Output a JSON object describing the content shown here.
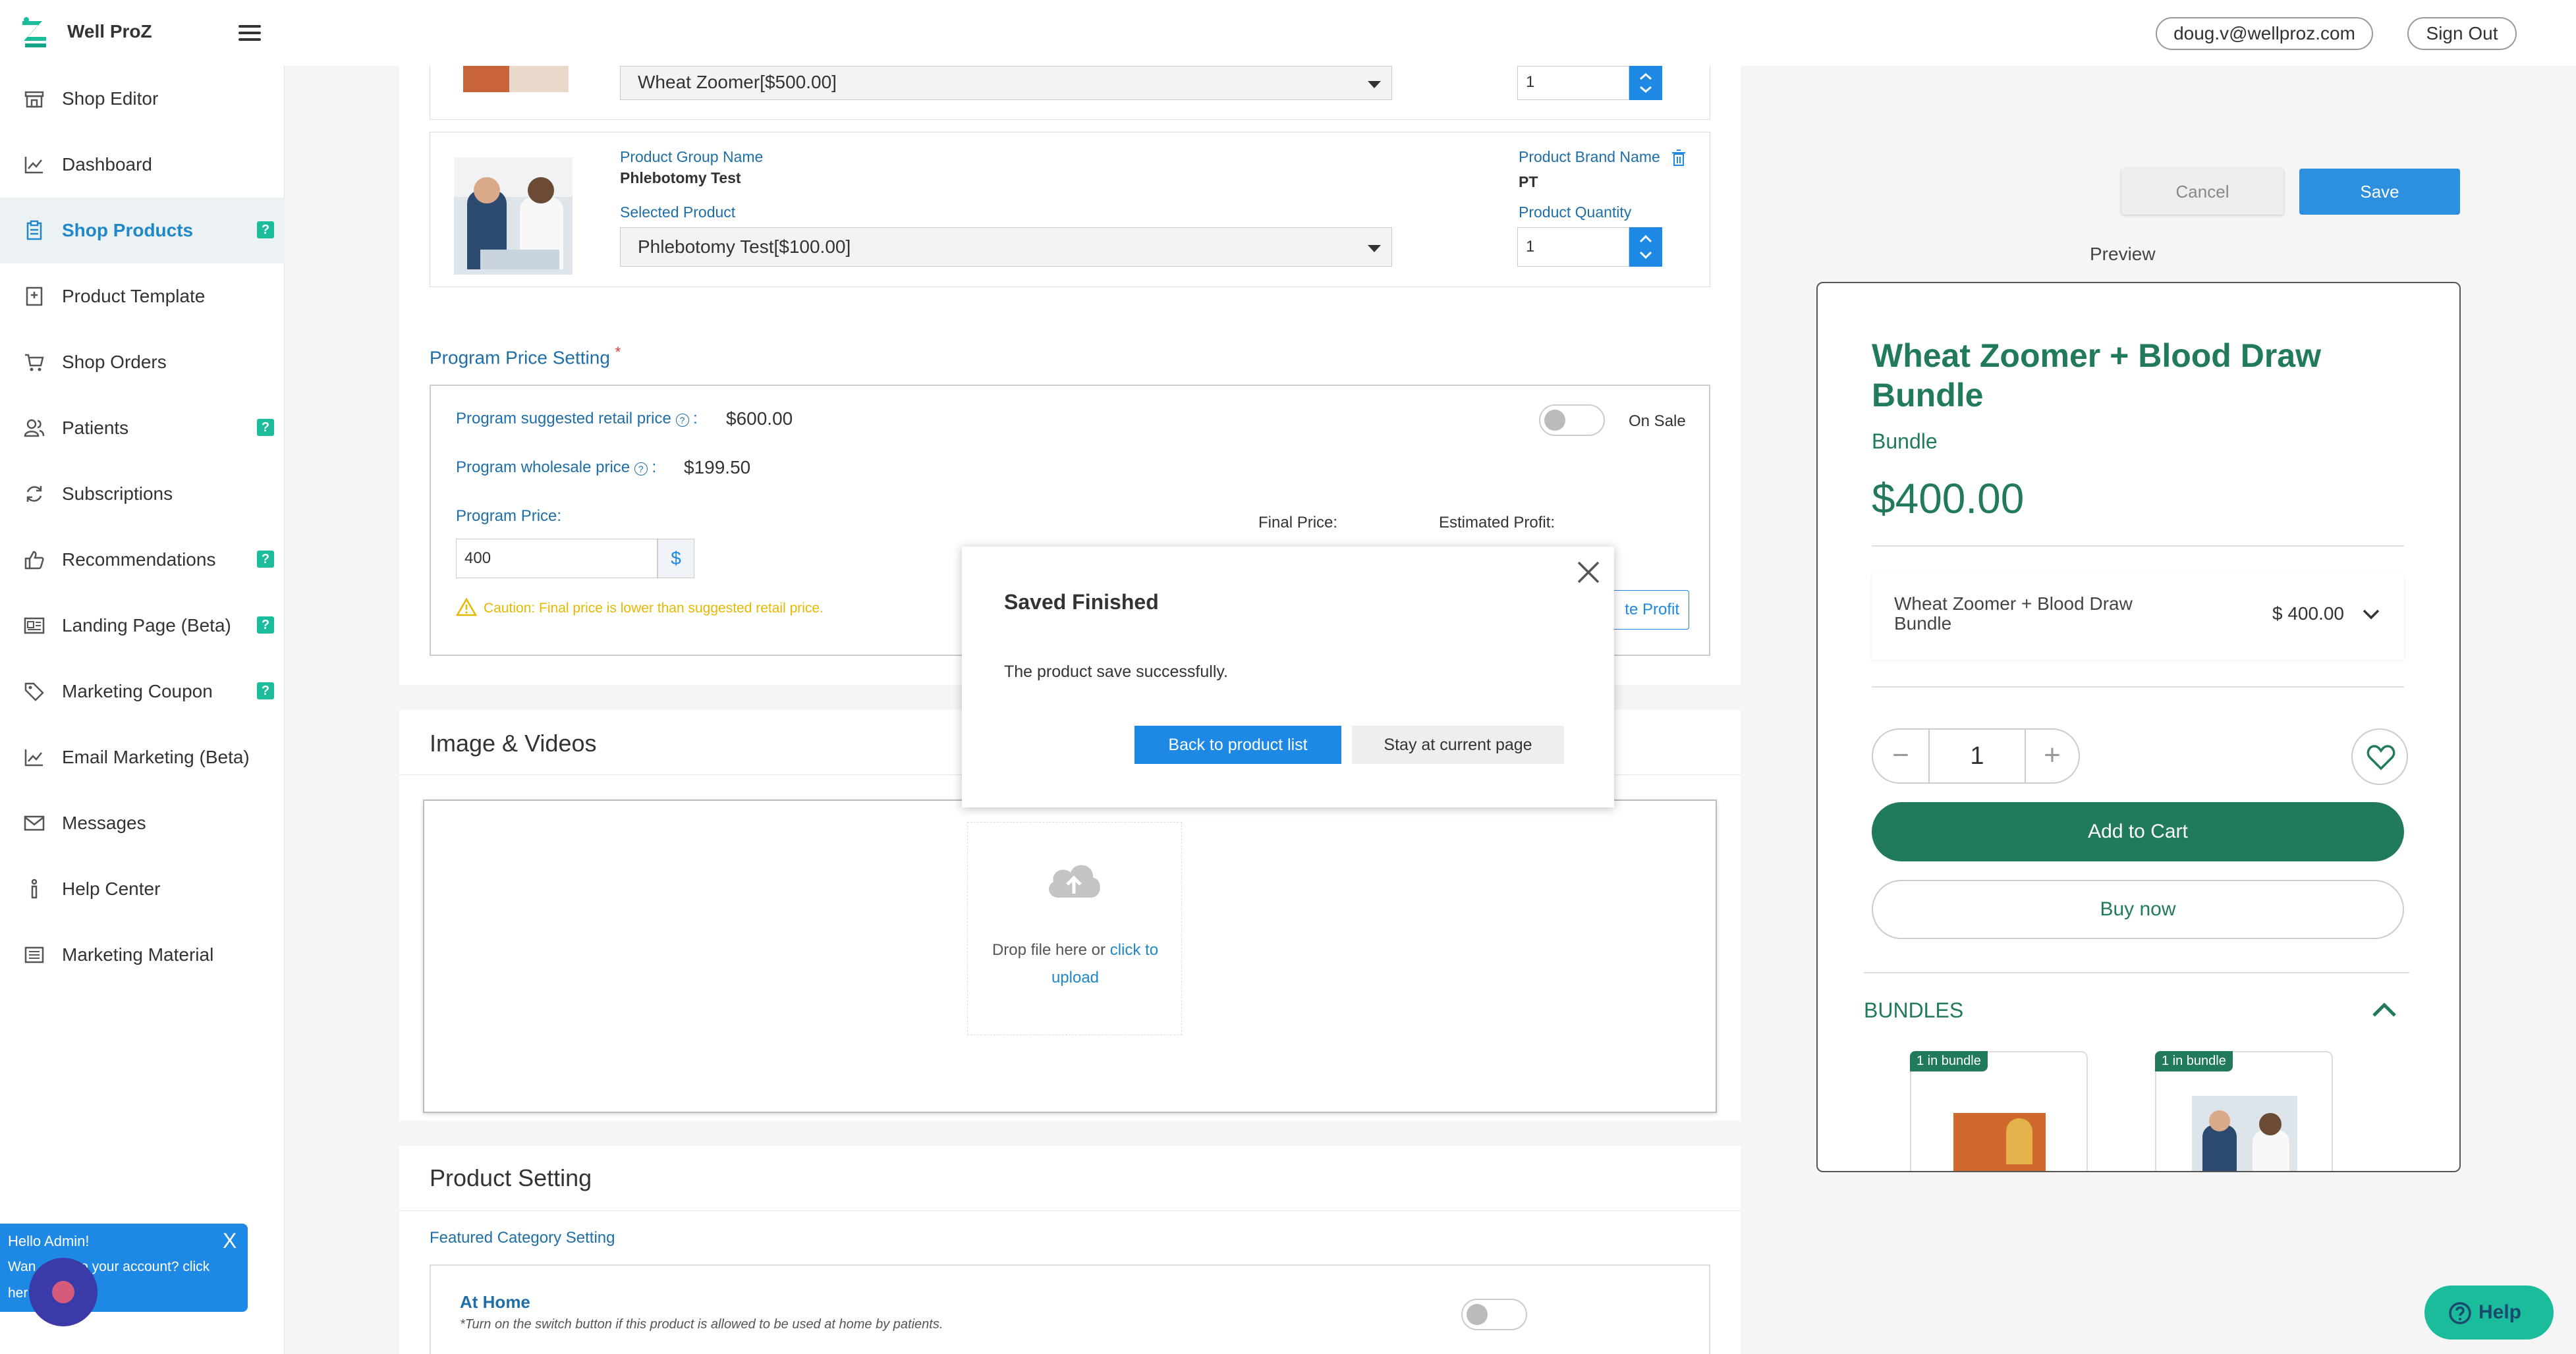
{
  "header": {
    "brand": "Well ProZ",
    "email": "doug.v@wellproz.com",
    "sign_out": "Sign Out"
  },
  "sidebar": {
    "items": [
      {
        "label": "Shop Editor",
        "icon": "store-icon",
        "help": false,
        "active": false
      },
      {
        "label": "Dashboard",
        "icon": "chart-icon",
        "help": false,
        "active": false
      },
      {
        "label": "Shop Products",
        "icon": "clipboard-icon",
        "help": true,
        "active": true
      },
      {
        "label": "Product Template",
        "icon": "template-icon",
        "help": false,
        "active": false
      },
      {
        "label": "Shop Orders",
        "icon": "cart-icon",
        "help": false,
        "active": false
      },
      {
        "label": "Patients",
        "icon": "users-icon",
        "help": true,
        "active": false
      },
      {
        "label": "Subscriptions",
        "icon": "refresh-icon",
        "help": false,
        "active": false
      },
      {
        "label": "Recommendations",
        "icon": "thumbs-up-icon",
        "help": true,
        "active": false
      },
      {
        "label": "Landing Page (Beta)",
        "icon": "landing-icon",
        "help": true,
        "active": false
      },
      {
        "label": "Marketing Coupon",
        "icon": "tag-icon",
        "help": true,
        "active": false
      },
      {
        "label": "Email Marketing (Beta)",
        "icon": "chart-icon",
        "help": false,
        "active": false
      },
      {
        "label": "Messages",
        "icon": "mail-icon",
        "help": false,
        "active": false
      },
      {
        "label": "Help Center",
        "icon": "help-icon",
        "help": false,
        "active": false
      },
      {
        "label": "Marketing Material",
        "icon": "document-icon",
        "help": false,
        "active": false
      }
    ],
    "help_mark": "?"
  },
  "products": {
    "first": {
      "selected": "Wheat Zoomer[$500.00]",
      "quantity": "1"
    },
    "second": {
      "group_label": "Product Group Name",
      "group_name": "Phlebotomy Test",
      "brand_label": "Product Brand Name",
      "brand_name": "PT",
      "selected_label": "Selected Product",
      "selected": "Phlebotomy Test[$100.00]",
      "quantity_label": "Product Quantity",
      "quantity": "1"
    }
  },
  "price": {
    "section_title": "Program Price Setting",
    "required_mark": "*",
    "retail_label": "Program suggested retail price",
    "retail_value": "$600.00",
    "wholesale_label": "Program wholesale price",
    "wholesale_value": "$199.50",
    "on_sale": "On Sale",
    "program_price_label": "Program Price:",
    "program_price_value": "400",
    "currency": "$",
    "final_price_label": "Final Price:",
    "estimated_profit_label": "Estimated Profit:",
    "caution": "Caution: Final price is lower than suggested retail price.",
    "calc_button_partial": "te Profit",
    "colon": ":"
  },
  "media": {
    "title": "Image & Videos",
    "drop_text": "Drop file here or",
    "click_text": "click to",
    "upload_text": "upload"
  },
  "product_setting": {
    "title": "Product Setting",
    "featured_label": "Featured Category Setting",
    "at_home_title": "At Home",
    "at_home_desc": "*Turn on the switch button if this product is allowed to be used at home by patients."
  },
  "modal": {
    "title": "Saved Finished",
    "message": "The product save successfully.",
    "back_button": "Back to product list",
    "stay_button": "Stay at current page"
  },
  "actions": {
    "cancel": "Cancel",
    "save": "Save",
    "preview_label": "Preview"
  },
  "preview": {
    "title": "Wheat Zoomer + Blood Draw Bundle",
    "subtitle": "Bundle",
    "price": "$400.00",
    "option_name": "Wheat Zoomer + Blood Draw Bundle",
    "option_price": "$ 400.00",
    "quantity": "1",
    "minus": "−",
    "plus": "+",
    "add_to_cart": "Add to Cart",
    "buy_now": "Buy now",
    "bundles_title": "BUNDLES",
    "bundle_badge": "1 in bundle"
  },
  "chat": {
    "greeting": "Hello Admin!",
    "line2": "Wan      ck to your account? click",
    "line3": "her",
    "close": "X"
  },
  "help_button": "Help",
  "colors": {
    "accent": "#1e88c8",
    "brand_green": "#217a5b",
    "save_blue": "#2d8fe0",
    "help_teal": "#1abc9c"
  }
}
